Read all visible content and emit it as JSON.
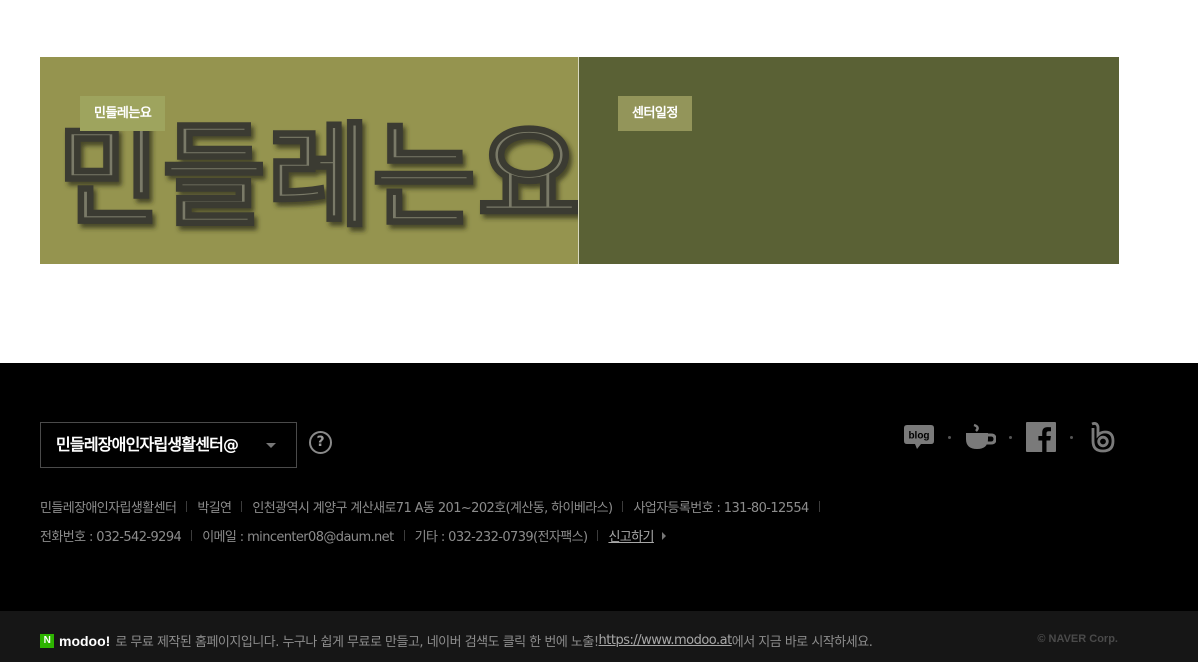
{
  "banner": {
    "left_tag": "민들레는요",
    "left_title": "민들레는요",
    "right_tag": "센터일정",
    "colors": {
      "left_bg": "#95944f",
      "right_bg": "#5a6135"
    }
  },
  "footer": {
    "site_select": "민들레장애인자립생활센터@",
    "help_icon": "?",
    "social_icons": [
      "blog-icon",
      "cafe-icon",
      "facebook-icon",
      "band-icon"
    ],
    "blog_label": "blog",
    "info_line1": [
      "민들레장애인자립생활센터",
      "박길연",
      "인천광역시 계양구 계산새로71 A동 201~202호(계산동, 하이베라스)",
      "사업자등록번호 : 131-80-12554"
    ],
    "info_line2": [
      "전화번호 : 032-542-9294",
      "이메일 : mincenter08@daum.net",
      "기타 : 032-232-0739(전자팩스)"
    ],
    "report_link": "신고하기"
  },
  "bottom_bar": {
    "logo_letter": "N",
    "brand": "modoo!",
    "text_before": "로 무료 제작된 홈페이지입니다. 누구나 쉽게 무료로 만들고, 네이버 검색도 클릭 한 번에 노출! ",
    "url": "https://www.modoo.at",
    "text_after": "에서 지금 바로 시작하세요.",
    "copyright": "© NAVER Corp."
  }
}
